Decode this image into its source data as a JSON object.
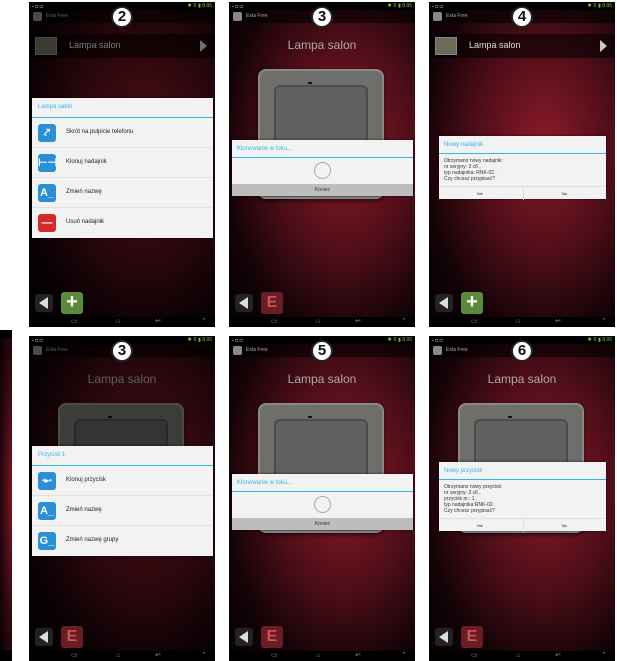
{
  "status_bar": {
    "icons": "▪ ◘ ◘",
    "right": "✱ ⊽ ▮ 8.06"
  },
  "app_name": "Exta Free",
  "room_name": "Lampa salon",
  "nav_keys": {
    "recent": "▭",
    "home": "⌂",
    "back": "↩",
    "up": "⌃"
  },
  "screens": [
    {
      "step": "2",
      "mode": "strip",
      "menu_title": "Lampa salon",
      "menu_items": [
        {
          "label": "Skrót na pulpicie telefonu",
          "icon": "shortcut-icon",
          "glyph": "⤤",
          "color": "#2a8fd6"
        },
        {
          "label": "Klonuj nadajnik",
          "icon": "clone-icon",
          "glyph": "⊢⊣",
          "color": "#2a8fd6"
        },
        {
          "label": "Zmień nazwę",
          "icon": "rename-icon",
          "glyph": "A_",
          "color": "#2a8fd6"
        },
        {
          "label": "Usuń nadajnik",
          "icon": "delete-icon",
          "glyph": "—",
          "color": "#d42a2a"
        }
      ],
      "bottom_button": "plus"
    },
    {
      "step": "3",
      "mode": "plate",
      "cloning_title": "Klonowanie w toku...",
      "cloning_button": "Koniec",
      "bottom_button": "E"
    },
    {
      "step": "4",
      "mode": "strip",
      "dialog_title": "Nowy nadajnik",
      "dialog_lines": [
        "Otrzymano nowy nadajnik:",
        "nr seryjny: 3 c6 ,",
        "typ nadajnika: RNK-02 .",
        "Czy chcesz przypisać?"
      ],
      "dialog_no": "Nie",
      "dialog_yes": "Tak",
      "bottom_button": "plus"
    },
    {
      "step": "3",
      "mode": "plate",
      "menu_title": "Przycisk 1",
      "menu_items": [
        {
          "label": "Klonuj przycisk",
          "icon": "clone-button-icon",
          "glyph": "•▸•",
          "color": "#2a8fd6"
        },
        {
          "label": "Zmień nazwę",
          "icon": "rename-icon",
          "glyph": "A_",
          "color": "#2a8fd6"
        },
        {
          "label": "Zmień nazwę grupy",
          "icon": "rename-group-icon",
          "glyph": "G_",
          "color": "#2a8fd6"
        }
      ],
      "bottom_button": "E"
    },
    {
      "step": "5",
      "mode": "plate",
      "cloning_title": "Klonowanie w toku...",
      "cloning_button": "Koniec",
      "bottom_button": "E"
    },
    {
      "step": "6",
      "mode": "plate",
      "dialog_title": "Nowy przycisk",
      "dialog_lines": [
        "Otrzymano nowy przycisk:",
        "nr seryjny: 3 c6 ,",
        "przycisk nr.: 1 ,",
        "typ nadajnika:RNK-02.",
        "Czy chcesz przypisać?"
      ],
      "dialog_no": "Nie",
      "dialog_yes": "Tak",
      "bottom_button": "E"
    }
  ]
}
